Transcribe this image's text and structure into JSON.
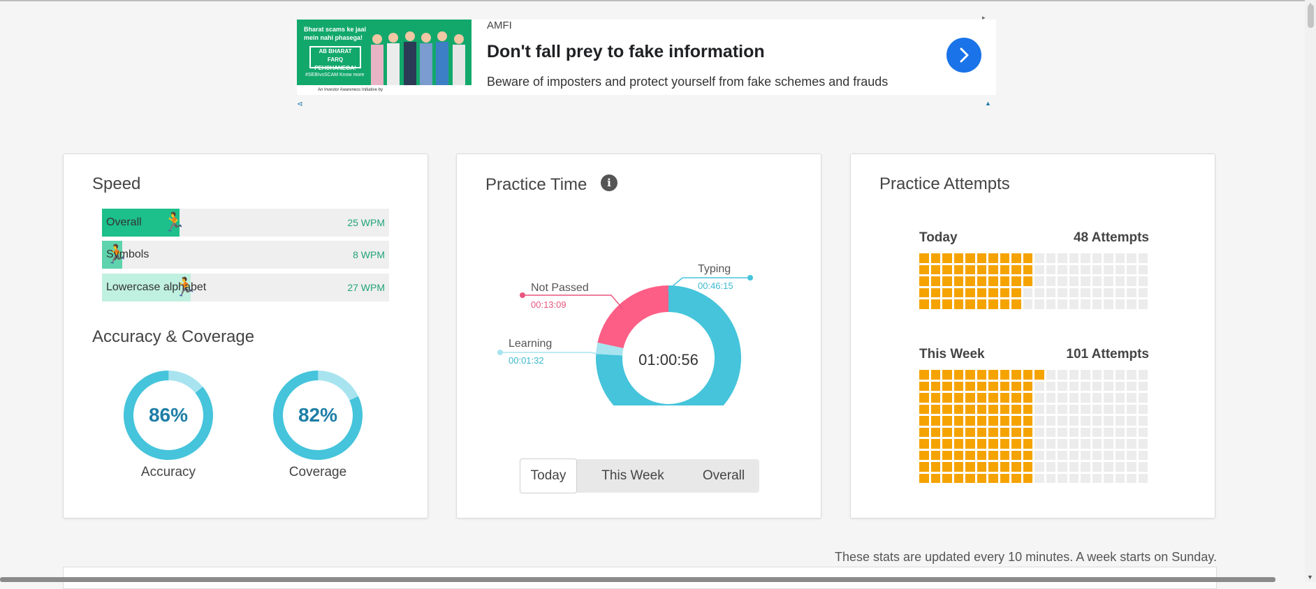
{
  "ad": {
    "brand": "AMFI",
    "title": "Don't fall prey to fake information",
    "subtitle": "Beware of imposters and protect yourself from fake schemes and frauds",
    "image_bubble": "Bharat scams ke jaal mein nahi phasega!",
    "image_badge": "AB BHARAT FARQ PEHCHANEGA!",
    "image_tag": "#SEBIvsSCAM  Know more",
    "image_foot": "An Investor Awareness Initiative by",
    "go_icon": "chevron-right-icon"
  },
  "speed": {
    "title": "Speed",
    "bars": [
      {
        "label": "Overall",
        "value": "25 WPM",
        "fill": 0.27,
        "color": "#1dbf8a"
      },
      {
        "label": "Symbols",
        "value": "8 WPM",
        "fill": 0.07,
        "color": "#5fd3ad"
      },
      {
        "label": "Lowercase alphabet",
        "value": "27 WPM",
        "fill": 0.31,
        "color": "#bff0e0"
      }
    ]
  },
  "accuracy": {
    "title": "Accuracy & Coverage",
    "gauges": [
      {
        "label": "Accuracy",
        "value": "86%",
        "fraction": 0.86
      },
      {
        "label": "Coverage",
        "value": "82%",
        "fraction": 0.82
      }
    ]
  },
  "practice_time": {
    "title": "Practice Time",
    "info_icon": "info-icon",
    "total": "01:00:56",
    "segments": [
      {
        "name": "Typing",
        "time": "00:46:15",
        "seconds": 2775,
        "color": "#45c4db",
        "label_color": "#3bb8cf"
      },
      {
        "name": "Learning",
        "time": "00:01:32",
        "seconds": 92,
        "color": "#a8e4ef",
        "label_color": "#3bb8cf"
      },
      {
        "name": "Not Passed",
        "time": "00:13:09",
        "seconds": 789,
        "color": "#fd5e86",
        "label_color": "#e8557e"
      }
    ],
    "tabs": [
      "Today",
      "This Week",
      "Overall"
    ],
    "active_tab": "Today"
  },
  "attempts": {
    "title": "Practice Attempts",
    "today": {
      "label": "Today",
      "count_text": "48 Attempts",
      "count": 48
    },
    "week": {
      "label": "This Week",
      "count_text": "101 Attempts",
      "count": 101
    }
  },
  "footnote": "These stats are updated every 10 minutes. A week starts on Sunday.",
  "colors": {
    "attempt_on": "#f5a300",
    "attempt_off": "#ececec",
    "ring": "#45c4db",
    "ring_track": "#a8e4ef"
  }
}
